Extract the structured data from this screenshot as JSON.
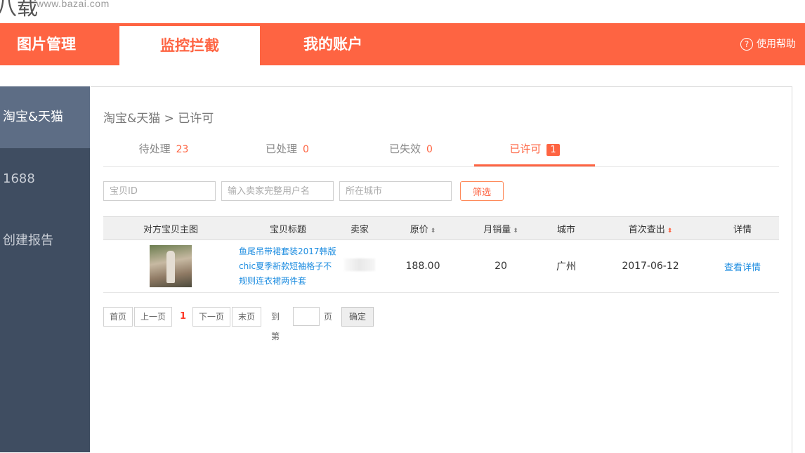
{
  "logo": {
    "mark": "八载",
    "url": "www.bazai.com"
  },
  "nav": {
    "tabs": [
      {
        "label": "图片管理"
      },
      {
        "label": "监控拦截"
      },
      {
        "label": "我的账户"
      }
    ],
    "help_label": "使用帮助",
    "help_icon": "?"
  },
  "sidebar": {
    "items": [
      {
        "label": "淘宝&天猫"
      },
      {
        "label": "1688"
      },
      {
        "label": "创建报告"
      }
    ]
  },
  "breadcrumb": "淘宝&天猫 > 已许可",
  "tabs": [
    {
      "label": "待处理",
      "count": "23"
    },
    {
      "label": "已处理",
      "count": "0"
    },
    {
      "label": "已失效",
      "count": "0"
    },
    {
      "label": "已许可",
      "count": "1"
    }
  ],
  "filters": {
    "id_placeholder": "宝贝ID",
    "seller_placeholder": "输入卖家完整用户名",
    "city_placeholder": "所在城市",
    "filter_button": "筛选"
  },
  "table": {
    "columns": [
      "对方宝贝主图",
      "宝贝标题",
      "卖家",
      "原价",
      "月销量",
      "城市",
      "首次查出",
      "详情"
    ],
    "sort_icon": "⬍",
    "rows": [
      {
        "title": "鱼尾吊带裙套装2017韩版chic夏季新款短袖格子不规则连衣裙两件套",
        "price": "188.00",
        "sales": "20",
        "city": "广州",
        "first_found": "2017-06-12",
        "detail": "查看详情"
      }
    ]
  },
  "pager": {
    "first": "首页",
    "prev": "上一页",
    "current": "1",
    "next": "下一页",
    "last": "末页",
    "goto": "到第",
    "page": "页",
    "ok": "确定"
  }
}
